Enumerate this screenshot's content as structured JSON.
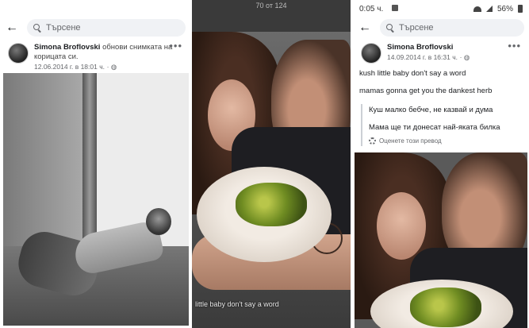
{
  "panel1": {
    "search_placeholder": "Търсене",
    "post": {
      "author": "Simona Broflovski",
      "action": "обнови снимката на корицата си.",
      "timestamp": "12.06.2014 г. в 18:01 ч.",
      "privacy_icon": "globe-icon"
    }
  },
  "panel2": {
    "top_text": "70 от 124",
    "caption": "little baby don't say a word"
  },
  "panel3": {
    "status": {
      "time": "0:05 ч.",
      "battery": "56%"
    },
    "search_placeholder": "Търсене",
    "post": {
      "author": "Simona Broflovski",
      "timestamp": "14.09.2014 г. в 16:31 ч.",
      "privacy_icon": "globe-icon",
      "lines": [
        "kush little baby don't say a word",
        "mamas gonna get you the dankest herb"
      ],
      "translation": [
        "Куш малко бебче, не казвай и дума",
        "Мама ще ти донесат най-яката билка"
      ],
      "rate_label": "Оценете този превод"
    }
  },
  "colors": {
    "search_bg": "#f0f2f5",
    "meta_text": "#65676b"
  }
}
